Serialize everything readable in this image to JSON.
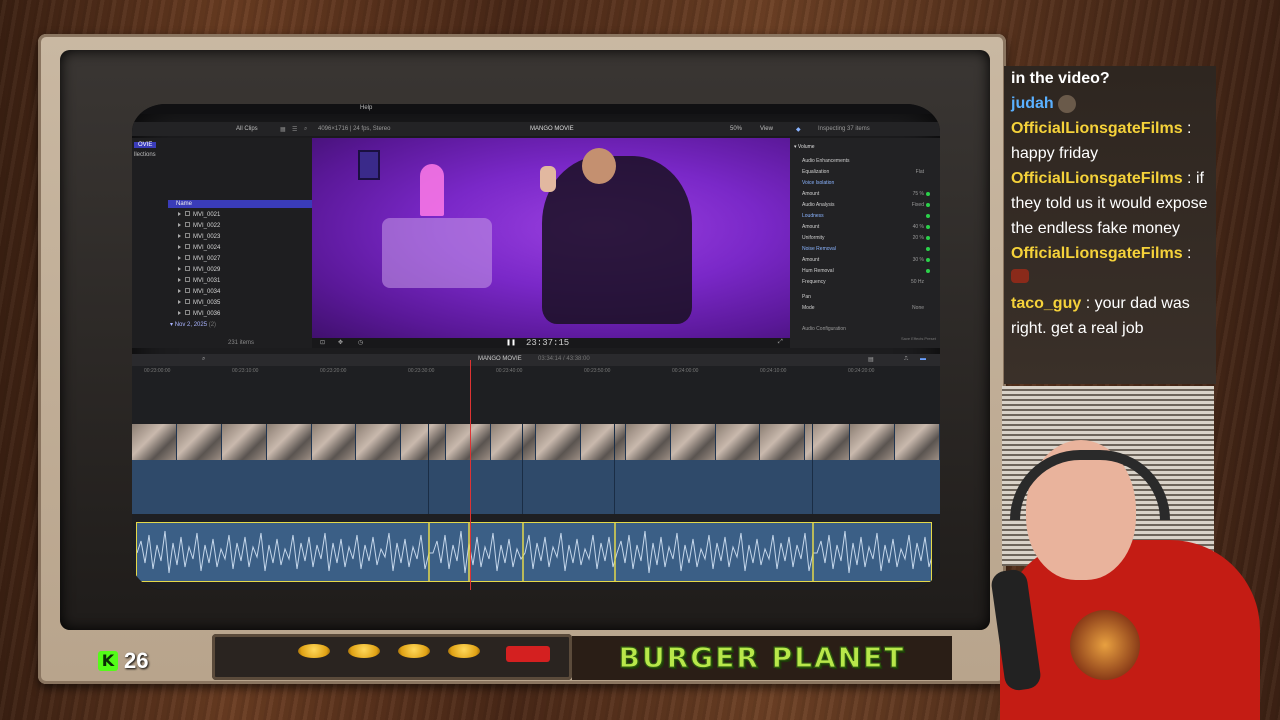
{
  "fcp": {
    "menu_text": "Help",
    "toolbar": {
      "filter": "All Clips",
      "format": "4096×1716 | 24 fps, Stereo",
      "project": "MANGO MOVIE",
      "zoom": "50%",
      "view": "View",
      "inspecting": "Inspecting 37 items"
    },
    "browser": {
      "sidebar_1": "OVIE",
      "sidebar_2": "llections",
      "list_header": "Name",
      "clips": [
        "MVI_0021",
        "MVI_0022",
        "MVI_0023",
        "MVI_0024",
        "MVI_0027",
        "MVI_0029",
        "MVI_0031",
        "MVI_0034",
        "MVI_0035",
        "MVI_0036"
      ],
      "date_group": "Nov 2, 2025",
      "date_count": "(2)",
      "item_count": "231 items"
    },
    "viewer": {
      "timecode": "23:37:15"
    },
    "inspector": {
      "section": "Volume",
      "rows": [
        {
          "label": "Audio Enhancements",
          "value": ""
        },
        {
          "label": "Equalization",
          "value": "Flat"
        },
        {
          "label": "Voice Isolation",
          "value": ""
        },
        {
          "label": "Amount",
          "value": "75 %"
        },
        {
          "label": "Audio Analysis",
          "value": "Fixed"
        },
        {
          "label": "Loudness",
          "value": ""
        },
        {
          "label": "Amount",
          "value": "40 %"
        },
        {
          "label": "Uniformity",
          "value": "20 %"
        },
        {
          "label": "Noise Removal",
          "value": ""
        },
        {
          "label": "Amount",
          "value": "30 %"
        },
        {
          "label": "Hum Removal",
          "value": ""
        },
        {
          "label": "Frequency",
          "value": "50 Hz"
        },
        {
          "label": "Pan",
          "value": ""
        },
        {
          "label": "Mode",
          "value": "None"
        },
        {
          "label": "Audio Configuration",
          "value": ""
        }
      ],
      "save_label": "Save Effects Preset"
    },
    "timeline": {
      "project": "MANGO MOVIE",
      "duration": "03:34:14 / 43:38:00",
      "ruler": [
        "00:23:00:00",
        "00:23:10:00",
        "00:23:20:00",
        "00:23:30:00",
        "00:23:40:00",
        "00:23:50:00",
        "00:24:00:00",
        "00:24:10:00",
        "00:24:20:00"
      ]
    }
  },
  "chat": [
    {
      "user": "",
      "message": "in the video?",
      "color": "#ffffff"
    },
    {
      "user": "judah",
      "message": "",
      "color": "#5ab0ff"
    },
    {
      "user": "OfficialLionsgateFilms",
      "message": ": happy friday",
      "color": "#f5d23a"
    },
    {
      "user": "OfficialLionsgateFilms",
      "message": ": if they told us it would expose the endless fake money",
      "color": "#f5d23a"
    },
    {
      "user": "OfficialLionsgateFilms",
      "message": ":",
      "color": "#f5d23a"
    },
    {
      "user": "taco_guy",
      "message": ": your dad was right. get a real job",
      "color": "#f5d23a"
    }
  ],
  "overlay": {
    "kick_count": "26",
    "kick_icon": "K",
    "sponsor": "BURGER PLANET"
  }
}
